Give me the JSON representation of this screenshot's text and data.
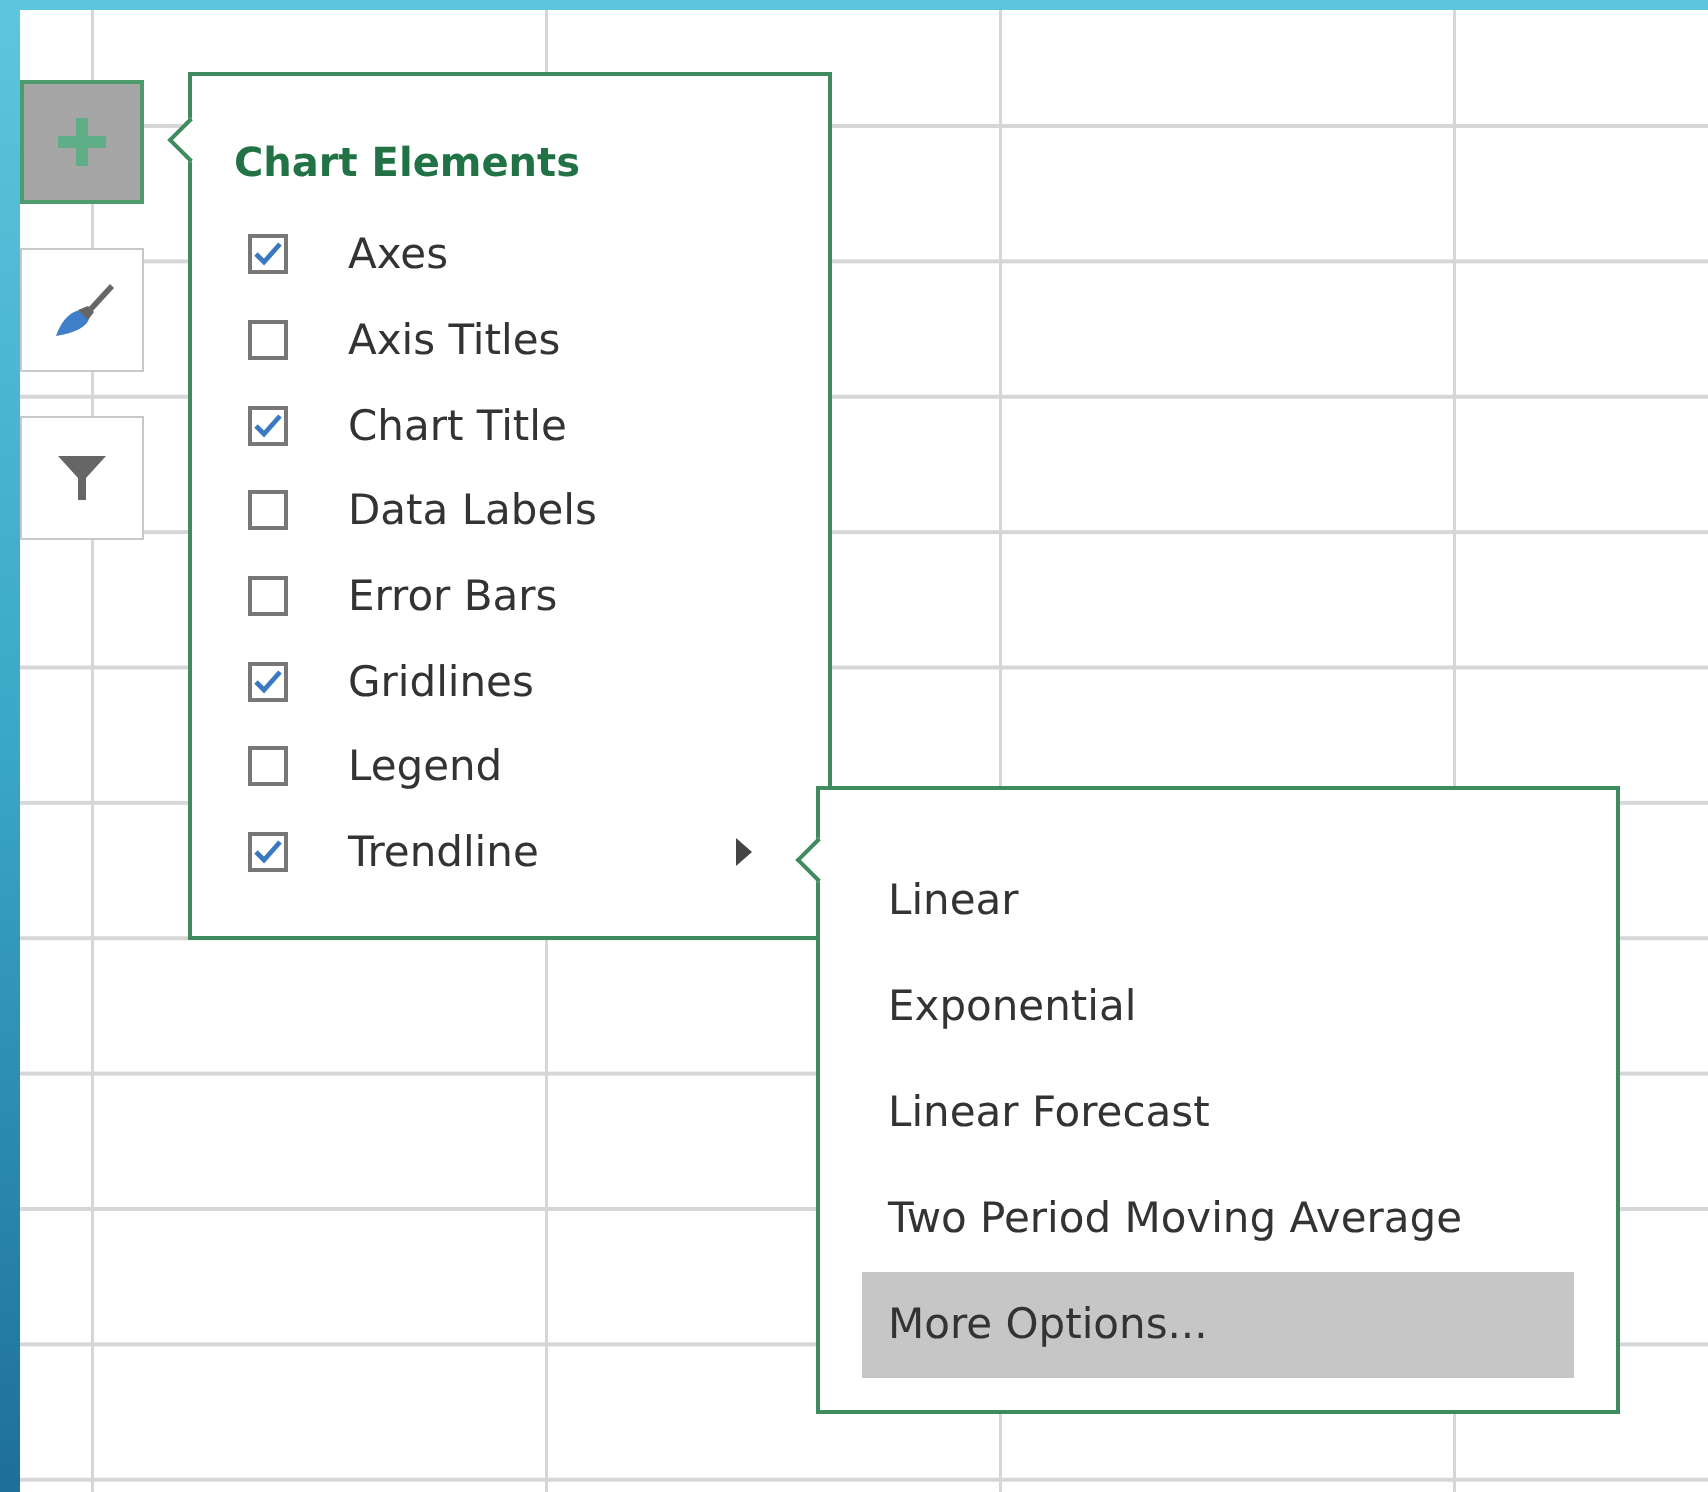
{
  "side_buttons": [
    {
      "kind": "add",
      "selected": true
    },
    {
      "kind": "style",
      "selected": false
    },
    {
      "kind": "filter",
      "selected": false
    }
  ],
  "chart_elements": {
    "title": "Chart Elements",
    "items": [
      {
        "label": "Axes",
        "checked": true,
        "has_submenu": false
      },
      {
        "label": "Axis Titles",
        "checked": false,
        "has_submenu": false
      },
      {
        "label": "Chart Title",
        "checked": true,
        "has_submenu": false
      },
      {
        "label": "Data Labels",
        "checked": false,
        "has_submenu": false
      },
      {
        "label": "Error Bars",
        "checked": false,
        "has_submenu": false
      },
      {
        "label": "Gridlines",
        "checked": true,
        "has_submenu": false
      },
      {
        "label": "Legend",
        "checked": false,
        "has_submenu": false
      },
      {
        "label": "Trendline",
        "checked": true,
        "has_submenu": true
      }
    ]
  },
  "trendline_menu": {
    "items": [
      {
        "label": "Linear",
        "selected": false
      },
      {
        "label": "Exponential",
        "selected": false
      },
      {
        "label": "Linear Forecast",
        "selected": false
      },
      {
        "label": "Two Period Moving Average",
        "selected": false
      },
      {
        "label": "More Options...",
        "selected": true
      }
    ]
  }
}
